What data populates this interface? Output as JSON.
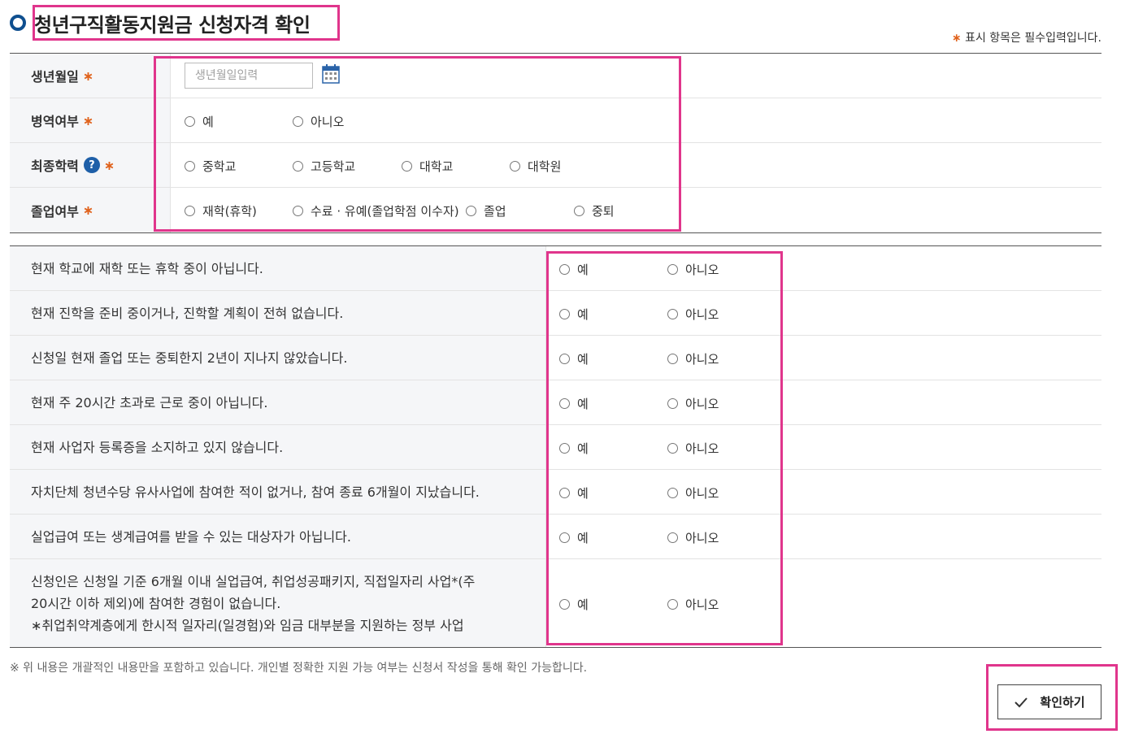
{
  "header": {
    "title": "청년구직활동지원금 신청자격 확인",
    "required_note_star": "∗",
    "required_note": "표시 항목은 필수입력입니다."
  },
  "form": {
    "birth": {
      "label": "생년월일",
      "placeholder": "생년월일입력",
      "value": "",
      "icon": "calendar-icon"
    },
    "military": {
      "label": "병역여부",
      "options": [
        "예",
        "아니오"
      ]
    },
    "education": {
      "label": "최종학력",
      "help_icon": "?",
      "options": [
        "중학교",
        "고등학교",
        "대학교",
        "대학원"
      ]
    },
    "graduation": {
      "label": "졸업여부",
      "options": [
        "재학(휴학)",
        "수료 · 유예(졸업학점 이수자)",
        "졸업",
        "중퇴"
      ]
    },
    "required_star": "∗"
  },
  "questions": [
    {
      "text": "현재 학교에 재학 또는 휴학 중이 아닙니다.",
      "yes": "예",
      "no": "아니오"
    },
    {
      "text": "현재 진학을 준비 중이거나, 진학할 계획이 전혀 없습니다.",
      "yes": "예",
      "no": "아니오"
    },
    {
      "text": "신청일 현재 졸업 또는 중퇴한지 2년이 지나지 않았습니다.",
      "yes": "예",
      "no": "아니오"
    },
    {
      "text": "현재 주 20시간 초과로 근로 중이 아닙니다.",
      "yes": "예",
      "no": "아니오"
    },
    {
      "text": "현재 사업자 등록증을 소지하고 있지 않습니다.",
      "yes": "예",
      "no": "아니오"
    },
    {
      "text": "자치단체 청년수당 유사사업에 참여한 적이 없거나, 참여 종료 6개월이 지났습니다.",
      "yes": "예",
      "no": "아니오"
    },
    {
      "text": "실업급여 또는 생계급여를 받을 수 있는 대상자가 아닙니다.",
      "yes": "예",
      "no": "아니오"
    },
    {
      "lines": [
        "신청인은 신청일 기준 6개월 이내 실업급여, 취업성공패키지, 직접일자리 사업*(주",
        "20시간 이하 제외)에 참여한 경험이 없습니다.",
        "∗취업취약계층에게 한시적 일자리(일경험)와 임금 대부분을 지원하는 정부 사업"
      ],
      "yes": "예",
      "no": "아니오"
    }
  ],
  "footnote": "※ 위 내용은 개괄적인 내용만을 포함하고 있습니다. 개인별 정확한 지원 가능 여부는 신청서 작성을 통해 확인 가능합니다.",
  "confirm_button": {
    "label": "확인하기",
    "icon": "check-icon"
  },
  "colors": {
    "title_bullet": "#0f4f8f",
    "required_star": "#e0621c",
    "highlight": "#e0358c",
    "label_bg": "#f5f6f8"
  }
}
